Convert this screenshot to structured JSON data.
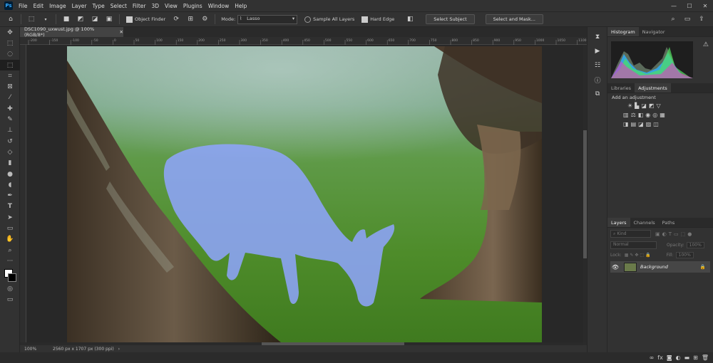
{
  "app": {
    "logo": "Ps"
  },
  "menu": [
    "File",
    "Edit",
    "Image",
    "Layer",
    "Type",
    "Select",
    "Filter",
    "3D",
    "View",
    "Plugins",
    "Window",
    "Help"
  ],
  "options": {
    "object_finder": "Object Finder",
    "mode_label": "Mode:",
    "mode_value": "Lasso",
    "sample_all_layers": "Sample All Layers",
    "hard_edge": "Hard Edge",
    "select_subject": "Select Subject",
    "select_and_mask": "Select and Mask..."
  },
  "document": {
    "tab_title": "DSC1090_uxwust.jpg @ 100% (RGB/8*)",
    "zoom": "100%",
    "info": "2560 px x 1707 px (300 ppi)"
  },
  "ruler_ticks": [
    "-200",
    "-150",
    "-100",
    "-50",
    "0",
    "50",
    "100",
    "150",
    "200",
    "250",
    "300",
    "350",
    "400",
    "450",
    "500",
    "550",
    "600",
    "650",
    "700",
    "750",
    "800",
    "850",
    "900",
    "950",
    "1000",
    "1050",
    "1100"
  ],
  "panels": {
    "top_tabs": [
      "Histogram",
      "Navigator"
    ],
    "mid_tabs": [
      "Libraries",
      "Adjustments"
    ],
    "add_adjustment": "Add an adjustment",
    "layer_tabs": [
      "Layers",
      "Channels",
      "Paths"
    ],
    "kind_placeholder": "Kind",
    "blend_mode": "Normal",
    "opacity_label": "Opacity:",
    "opacity_value": "100%",
    "lock_label": "Lock:",
    "fill_label": "Fill:",
    "fill_value": "100%",
    "layers": [
      {
        "name": "Background"
      }
    ]
  },
  "colors": {
    "accent": "#31a8ff",
    "panel": "#323232",
    "selection_overlay": "#8fa5ff"
  }
}
